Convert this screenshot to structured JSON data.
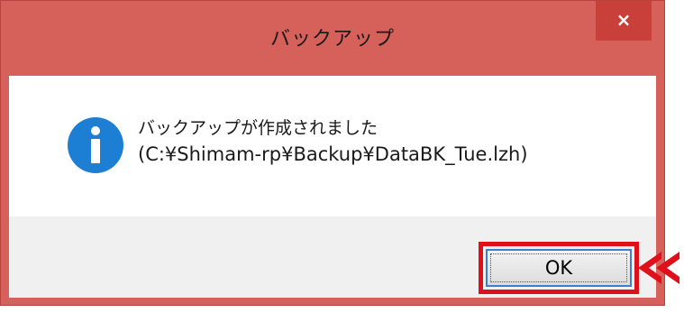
{
  "window": {
    "title": "バックアップ",
    "close_label": "×"
  },
  "message": {
    "icon": "info-icon",
    "line1": "バックアップが作成されました",
    "line2": "(C:¥Shimam-rp¥Backup¥DataBK_Tue.lzh)"
  },
  "buttons": {
    "ok_label": "OK"
  },
  "colors": {
    "title_bar": "#d6605a",
    "close_button": "#c9403b",
    "info_icon": "#1c7fd4",
    "highlight": "#e0101a"
  }
}
